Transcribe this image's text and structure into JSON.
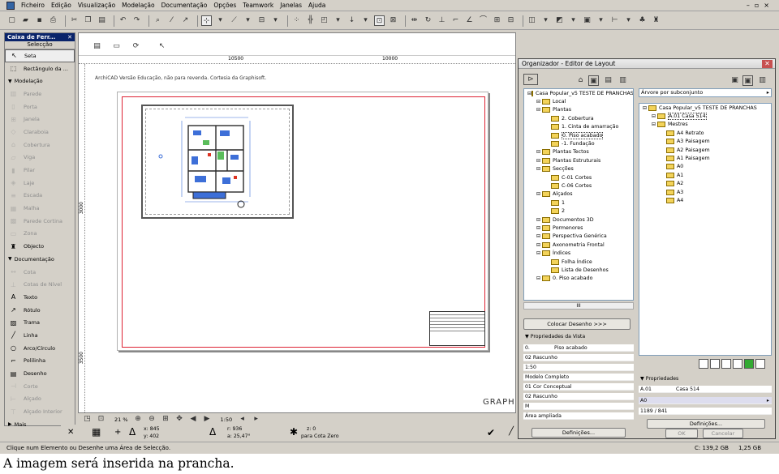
{
  "menubar": {
    "items": [
      "Ficheiro",
      "Edição",
      "Visualização",
      "Modelação",
      "Documentação",
      "Opções",
      "Teamwork",
      "Janelas",
      "Ajuda"
    ]
  },
  "toolbox": {
    "title": "Caixa de Ferr...",
    "subtitle": "Selecção",
    "tools": [
      {
        "label": "Seta",
        "icon": "arrow-icon",
        "glyph": "↖",
        "state": "selected"
      },
      {
        "label": "Rectângulo da ...",
        "icon": "marquee-icon",
        "glyph": "⬚",
        "state": "normal"
      },
      {
        "label": "Modelação",
        "icon": "",
        "glyph": "",
        "state": "section"
      },
      {
        "label": "Parede",
        "icon": "wall-icon",
        "glyph": "▥",
        "state": "dim"
      },
      {
        "label": "Porta",
        "icon": "door-icon",
        "glyph": "▯",
        "state": "dim"
      },
      {
        "label": "Janela",
        "icon": "window-icon",
        "glyph": "⊞",
        "state": "dim"
      },
      {
        "label": "Claraboia",
        "icon": "skylight-icon",
        "glyph": "◇",
        "state": "dim"
      },
      {
        "label": "Cobertura",
        "icon": "roof-icon",
        "glyph": "⌂",
        "state": "dim"
      },
      {
        "label": "Viga",
        "icon": "beam-icon",
        "glyph": "▱",
        "state": "dim"
      },
      {
        "label": "Pilar",
        "icon": "column-icon",
        "glyph": "▮",
        "state": "dim"
      },
      {
        "label": "Laje",
        "icon": "slab-icon",
        "glyph": "◈",
        "state": "dim"
      },
      {
        "label": "Escada",
        "icon": "stair-icon",
        "glyph": "≡",
        "state": "dim"
      },
      {
        "label": "Malha",
        "icon": "mesh-icon",
        "glyph": "▦",
        "state": "dim"
      },
      {
        "label": "Parede Cortina",
        "icon": "curtain-wall-icon",
        "glyph": "▩",
        "state": "dim"
      },
      {
        "label": "Zona",
        "icon": "zone-icon",
        "glyph": "▭",
        "state": "dim"
      },
      {
        "label": "Objecto",
        "icon": "object-icon",
        "glyph": "♜",
        "state": "normal"
      },
      {
        "label": "Documentação",
        "icon": "",
        "glyph": "",
        "state": "section"
      },
      {
        "label": "Cota",
        "icon": "dimension-icon",
        "glyph": "↔",
        "state": "dim"
      },
      {
        "label": "Cotas de Nível",
        "icon": "level-dimension-icon",
        "glyph": "⊥",
        "state": "dim"
      },
      {
        "label": "Texto",
        "icon": "text-icon",
        "glyph": "A",
        "state": "normal"
      },
      {
        "label": "Rótulo",
        "icon": "label-icon",
        "glyph": "↗",
        "state": "normal"
      },
      {
        "label": "Trama",
        "icon": "fill-icon",
        "glyph": "▨",
        "state": "normal"
      },
      {
        "label": "Linha",
        "icon": "line-icon",
        "glyph": "╱",
        "state": "normal"
      },
      {
        "label": "Arco/Círculo",
        "icon": "arc-circle-icon",
        "glyph": "○",
        "state": "normal"
      },
      {
        "label": "Polilinha",
        "icon": "polyline-icon",
        "glyph": "⌐",
        "state": "normal"
      },
      {
        "label": "Desenho",
        "icon": "drawing-icon",
        "glyph": "▤",
        "state": "normal"
      },
      {
        "label": "Corte",
        "icon": "section-icon",
        "glyph": "⊣",
        "state": "dim"
      },
      {
        "label": "Alçado",
        "icon": "elevation-icon",
        "glyph": "⊢",
        "state": "dim"
      },
      {
        "label": "Alçado Interior",
        "icon": "interior-elevation-icon",
        "glyph": "⊤",
        "state": "dim"
      },
      {
        "label": "Mais",
        "icon": "",
        "glyph": "",
        "state": "more"
      }
    ]
  },
  "canvas": {
    "ruler_h_1": "10500",
    "ruler_h_2": "10000",
    "ruler_v_1": "3000",
    "ruler_v_2": "3500",
    "watermark": "ArchiCAD Versão Educação, não para revenda. Cortesia da Graphisoft."
  },
  "bottombar": {
    "zoom": "21 %",
    "scale": "1:50"
  },
  "coords": {
    "x_label": "x: 845",
    "y_label": "y: 402",
    "r_label": "r: 936",
    "a_label": "a: 25,47°",
    "z_label": "z: 0",
    "z_ref": "para Cota Zero"
  },
  "organizer": {
    "title": "Organizador - Editor de Layout",
    "left_tree": [
      {
        "depth": 0,
        "label": "Casa Popular_v5 TESTE DE PRANCHAS"
      },
      {
        "depth": 1,
        "label": "Local"
      },
      {
        "depth": 1,
        "label": "Plantas"
      },
      {
        "depth": 2,
        "label": "2. Cobertura"
      },
      {
        "depth": 2,
        "label": "1. Cinta de amarração"
      },
      {
        "depth": 2,
        "label": "0. Piso acabado",
        "selected": true
      },
      {
        "depth": 2,
        "label": "-1. Fundação"
      },
      {
        "depth": 1,
        "label": "Plantas Tectos"
      },
      {
        "depth": 1,
        "label": "Plantas Estruturais"
      },
      {
        "depth": 1,
        "label": "Secções"
      },
      {
        "depth": 2,
        "label": "C-01 Cortes"
      },
      {
        "depth": 2,
        "label": "C-06 Cortes"
      },
      {
        "depth": 1,
        "label": "Alçados"
      },
      {
        "depth": 2,
        "label": "1"
      },
      {
        "depth": 2,
        "label": "2"
      },
      {
        "depth": 1,
        "label": "Documentos 3D"
      },
      {
        "depth": 1,
        "label": "Pormenores"
      },
      {
        "depth": 1,
        "label": "Perspectiva Genérica"
      },
      {
        "depth": 1,
        "label": "Axonometria Frontal"
      },
      {
        "depth": 1,
        "label": "Índices"
      },
      {
        "depth": 2,
        "label": "Folha Índice"
      },
      {
        "depth": 2,
        "label": "Lista de Desenhos"
      },
      {
        "depth": 1,
        "label": "0. Piso acabado"
      }
    ],
    "scroll_label": "III",
    "place_button": "Colocar Desenho >>>",
    "view_props_header": "Propriedades da Vista",
    "view_props": [
      {
        "id": "0.",
        "value": "Piso acabado"
      },
      {
        "id": "02 Rascunho",
        "value": ""
      },
      {
        "id": "1:50",
        "value": ""
      },
      {
        "id": "Modelo Completo",
        "value": ""
      },
      {
        "id": "01 Cor Conceptual",
        "value": ""
      },
      {
        "id": "02 Rascunho",
        "value": ""
      },
      {
        "id": "M",
        "value": ""
      },
      {
        "id": "Área ampliada",
        "value": ""
      }
    ],
    "definitions_left": "Definições...",
    "right_combo": "Árvore por subconjunto",
    "right_tree": [
      {
        "depth": 0,
        "label": "Casa Popular_v5 TESTE DE PRANCHAS"
      },
      {
        "depth": 1,
        "label": "A.01 Casa 514",
        "selected": true
      },
      {
        "depth": 1,
        "label": "Mestres"
      },
      {
        "depth": 2,
        "label": "A4 Retrato"
      },
      {
        "depth": 2,
        "label": "A3 Paisagem"
      },
      {
        "depth": 2,
        "label": "A2 Paisagem"
      },
      {
        "depth": 2,
        "label": "A1 Paisagem"
      },
      {
        "depth": 2,
        "label": "A0"
      },
      {
        "depth": 2,
        "label": "A1"
      },
      {
        "depth": 2,
        "label": "A2"
      },
      {
        "depth": 2,
        "label": "A3"
      },
      {
        "depth": 2,
        "label": "A4"
      }
    ],
    "props_header": "Propriedades",
    "sheet_id": "A.01",
    "sheet_name": "Casa 514",
    "master": "A0",
    "size": "1189 / 841",
    "definitions_right": "Definições..."
  },
  "right_panel": {
    "ok": "OK",
    "cancel": "Cancelar",
    "graphisoft": "GRAPHI"
  },
  "status": {
    "hint": "Clique num Elemento ou Desenhe uma Área de Selecção.",
    "disk": "C: 139,2 GB",
    "ram": "1,25 GB"
  },
  "caption": "A imagem será inserida na prancha."
}
